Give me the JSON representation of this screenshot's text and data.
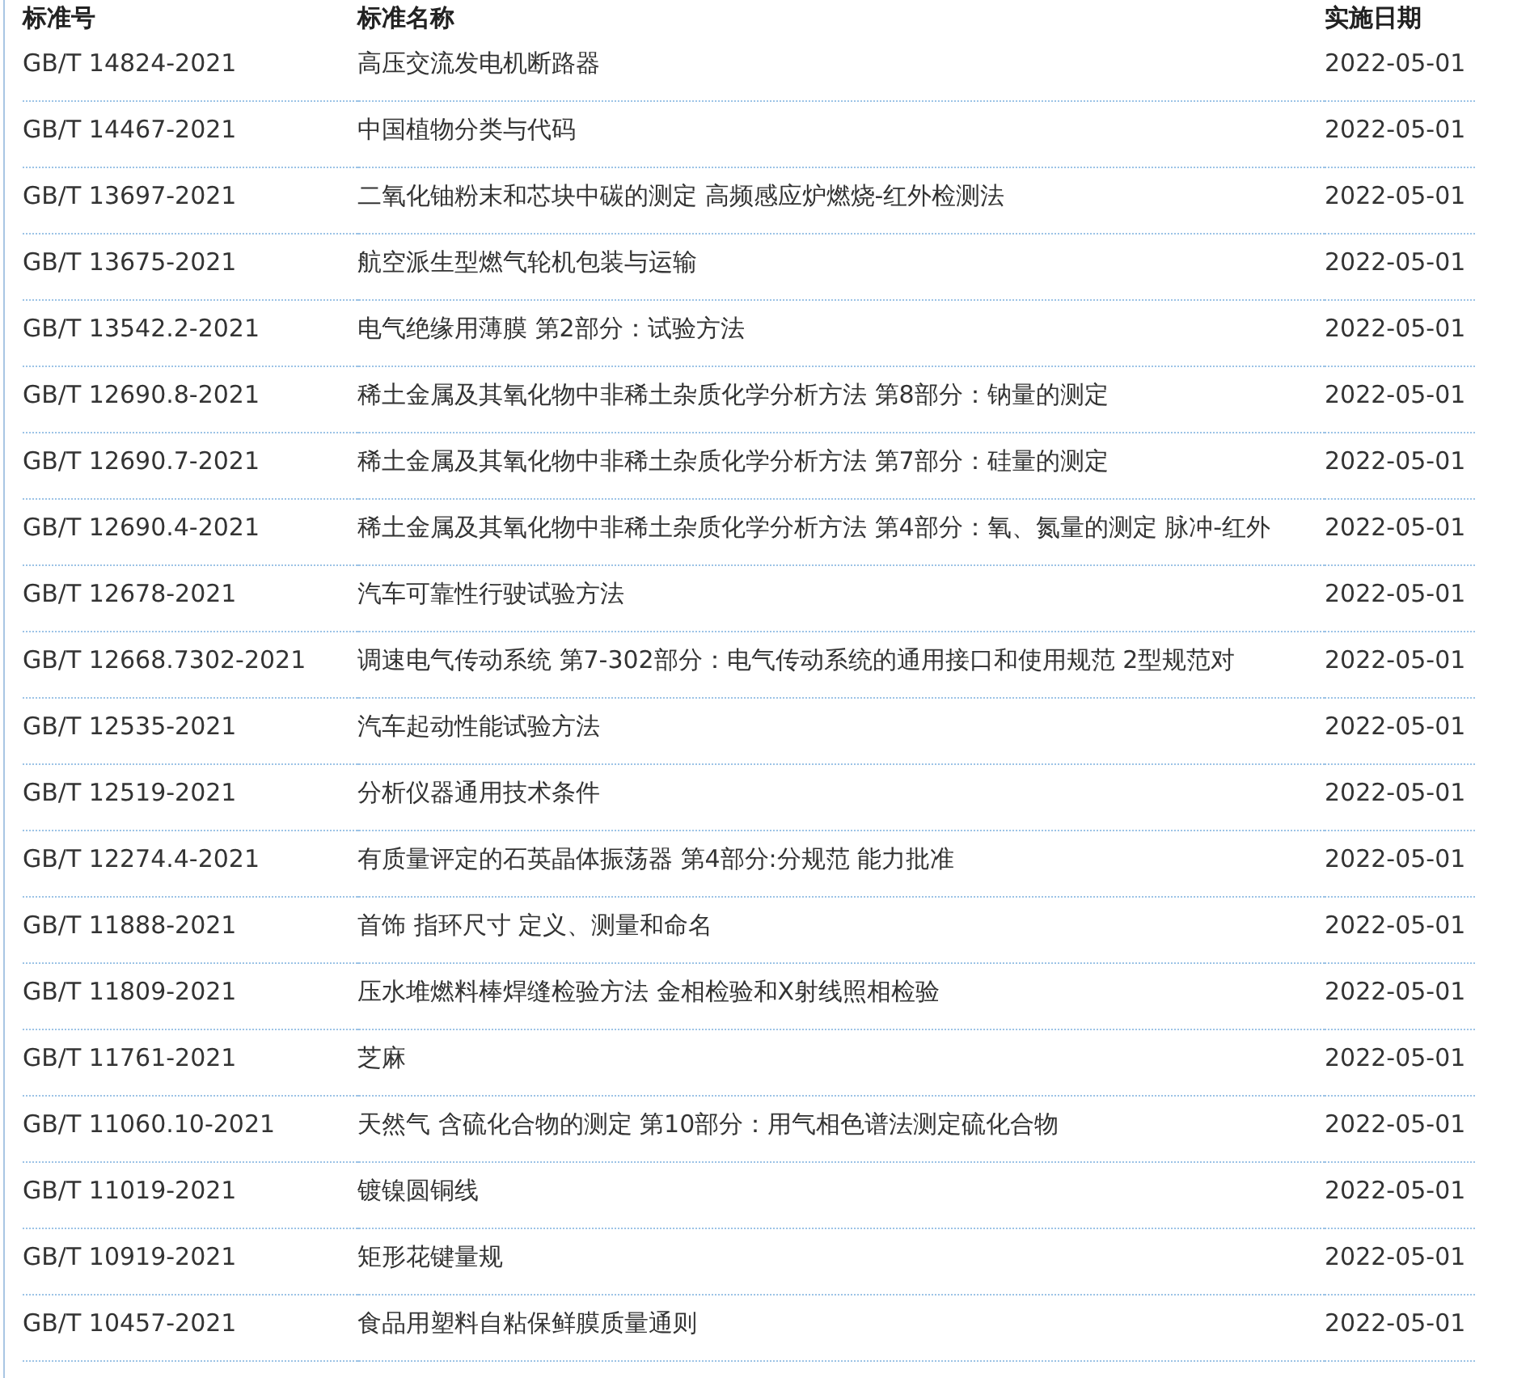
{
  "table": {
    "columns": [
      "标准号",
      "标准名称",
      "实施日期"
    ],
    "rows": [
      [
        "GB/T 14824-2021",
        "高压交流发电机断路器",
        "2022-05-01"
      ],
      [
        "GB/T 14467-2021",
        "中国植物分类与代码",
        "2022-05-01"
      ],
      [
        "GB/T 13697-2021",
        "二氧化铀粉末和芯块中碳的测定 高频感应炉燃烧-红外检测法",
        "2022-05-01"
      ],
      [
        "GB/T 13675-2021",
        "航空派生型燃气轮机包装与运输",
        "2022-05-01"
      ],
      [
        "GB/T 13542.2-2021",
        "电气绝缘用薄膜 第2部分：试验方法",
        "2022-05-01"
      ],
      [
        "GB/T 12690.8-2021",
        "稀土金属及其氧化物中非稀土杂质化学分析方法 第8部分：钠量的测定",
        "2022-05-01"
      ],
      [
        "GB/T 12690.7-2021",
        "稀土金属及其氧化物中非稀土杂质化学分析方法 第7部分：硅量的测定",
        "2022-05-01"
      ],
      [
        "GB/T 12690.4-2021",
        "稀土金属及其氧化物中非稀土杂质化学分析方法 第4部分：氧、氮量的测定 脉冲-红外",
        "2022-05-01"
      ],
      [
        "GB/T 12678-2021",
        "汽车可靠性行驶试验方法",
        "2022-05-01"
      ],
      [
        "GB/T 12668.7302-2021",
        "调速电气传动系统 第7-302部分：电气传动系统的通用接口和使用规范 2型规范对",
        "2022-05-01"
      ],
      [
        "GB/T 12535-2021",
        "汽车起动性能试验方法",
        "2022-05-01"
      ],
      [
        "GB/T 12519-2021",
        "分析仪器通用技术条件",
        "2022-05-01"
      ],
      [
        "GB/T 12274.4-2021",
        "有质量评定的石英晶体振荡器 第4部分:分规范 能力批准",
        "2022-05-01"
      ],
      [
        "GB/T 11888-2021",
        "首饰 指环尺寸 定义、测量和命名",
        "2022-05-01"
      ],
      [
        "GB/T 11809-2021",
        "压水堆燃料棒焊缝检验方法 金相检验和X射线照相检验",
        "2022-05-01"
      ],
      [
        "GB/T 11761-2021",
        "芝麻",
        "2022-05-01"
      ],
      [
        "GB/T 11060.10-2021",
        "天然气 含硫化合物的测定 第10部分：用气相色谱法测定硫化合物",
        "2022-05-01"
      ],
      [
        "GB/T 11019-2021",
        "镀镍圆铜线",
        "2022-05-01"
      ],
      [
        "GB/T 10919-2021",
        "矩形花键量规",
        "2022-05-01"
      ],
      [
        "GB/T 10457-2021",
        "食品用塑料自粘保鲜膜质量通则",
        "2022-05-01"
      ]
    ]
  }
}
